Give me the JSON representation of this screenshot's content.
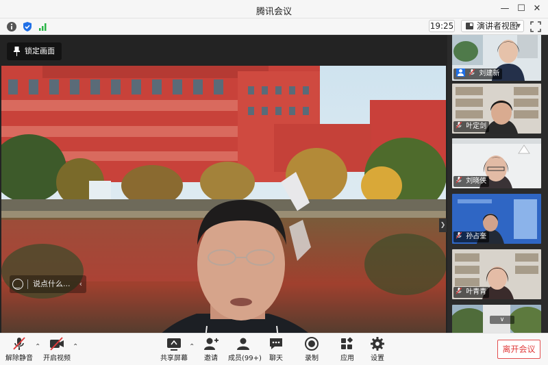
{
  "app": {
    "title": "腾讯会议"
  },
  "window": {
    "min_icon": "minimize-icon",
    "max_icon": "maximize-icon",
    "close_icon": "close-icon"
  },
  "infobar": {
    "icons": [
      "info-icon",
      "shield-icon",
      "signal-icon"
    ],
    "time": "19:25",
    "view_label": "演讲者视图"
  },
  "stage": {
    "lock_label": "锁定画面",
    "chat_placeholder": "说点什么..."
  },
  "participants": [
    {
      "name": "刘建新",
      "host": true
    },
    {
      "name": "叶定剑",
      "host": false
    },
    {
      "name": "刘晓侠",
      "host": false
    },
    {
      "name": "孙占奎",
      "host": false
    },
    {
      "name": "叶青青",
      "host": false
    },
    {
      "name": "",
      "host": false
    }
  ],
  "toolbar": {
    "mute": "解除静音",
    "video": "开启视频",
    "share": "共享屏幕",
    "invite": "邀请",
    "members": "成员(99+)",
    "chat": "聊天",
    "record": "录制",
    "apps": "应用",
    "settings": "设置",
    "leave": "离开会议"
  },
  "colors": {
    "accent": "#1f6fe6",
    "leave": "#e03c3c",
    "muted_red": "#e03c3c"
  }
}
